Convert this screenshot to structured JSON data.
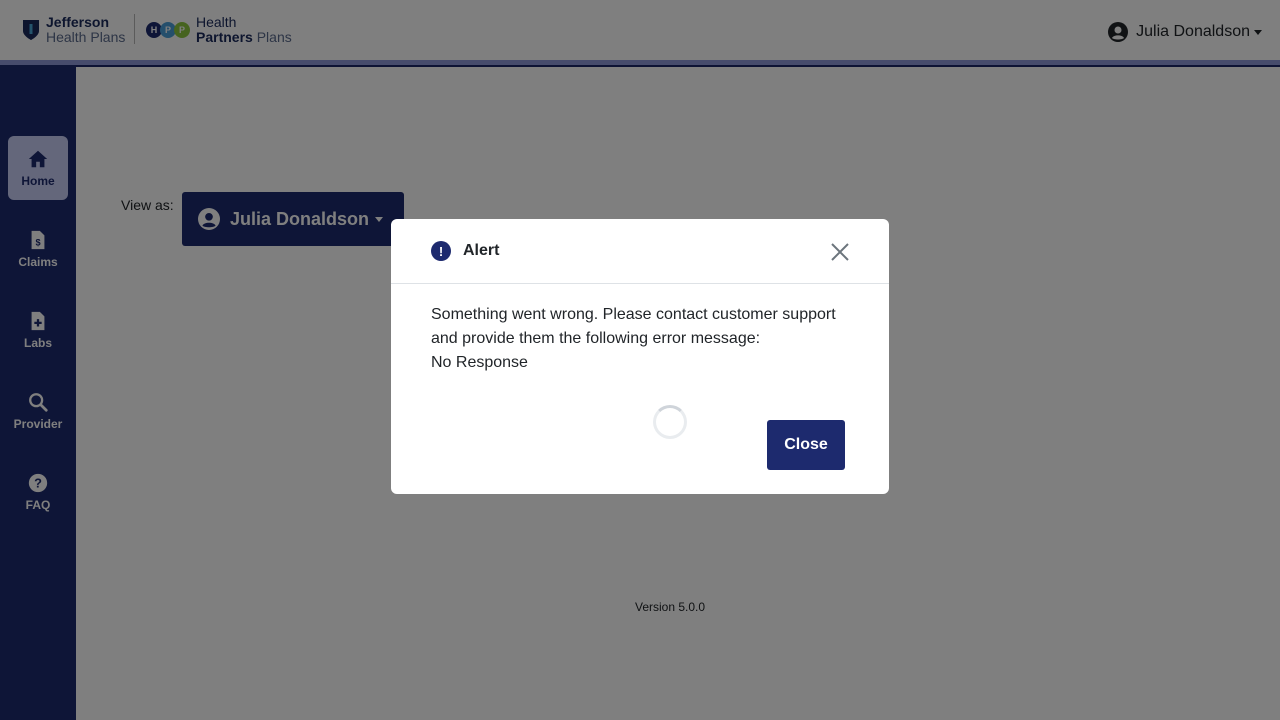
{
  "header": {
    "logo_jefferson_line1": "Jefferson",
    "logo_jefferson_line2": "Health Plans",
    "logo_hpp_letters": [
      "H",
      "P",
      "P"
    ],
    "logo_hpp_line1": "Health",
    "logo_hpp_line2_bold": "Partners",
    "logo_hpp_line2_light": "Plans",
    "user_name": "Julia Donaldson",
    "user_icon": "user-circle-icon"
  },
  "sidebar": {
    "items": [
      {
        "label": "Home",
        "icon": "home-icon",
        "active": true
      },
      {
        "label": "Claims",
        "icon": "invoice-dollar-icon",
        "active": false
      },
      {
        "label": "Labs",
        "icon": "file-medical-icon",
        "active": false
      },
      {
        "label": "Provider",
        "icon": "search-icon",
        "active": false
      },
      {
        "label": "FAQ",
        "icon": "question-circle-icon",
        "active": false
      }
    ]
  },
  "main": {
    "view_as_label": "View as:",
    "view_as_value": "Julia Donaldson",
    "version": "Version 5.0.0"
  },
  "modal": {
    "title": "Alert",
    "message_line1": "Something went wrong. Please contact customer support and provide them the following error message:",
    "message_line2": "No Response",
    "close_label": "Close"
  },
  "colors": {
    "brand_navy": "#1d2a6e",
    "sidebar_active": "#c9cff7",
    "header_accent": "#8e98d8",
    "hpp_h": "#1d2a6e",
    "hpp_p1": "#4a9fd8",
    "hpp_p2": "#8cc63f"
  }
}
